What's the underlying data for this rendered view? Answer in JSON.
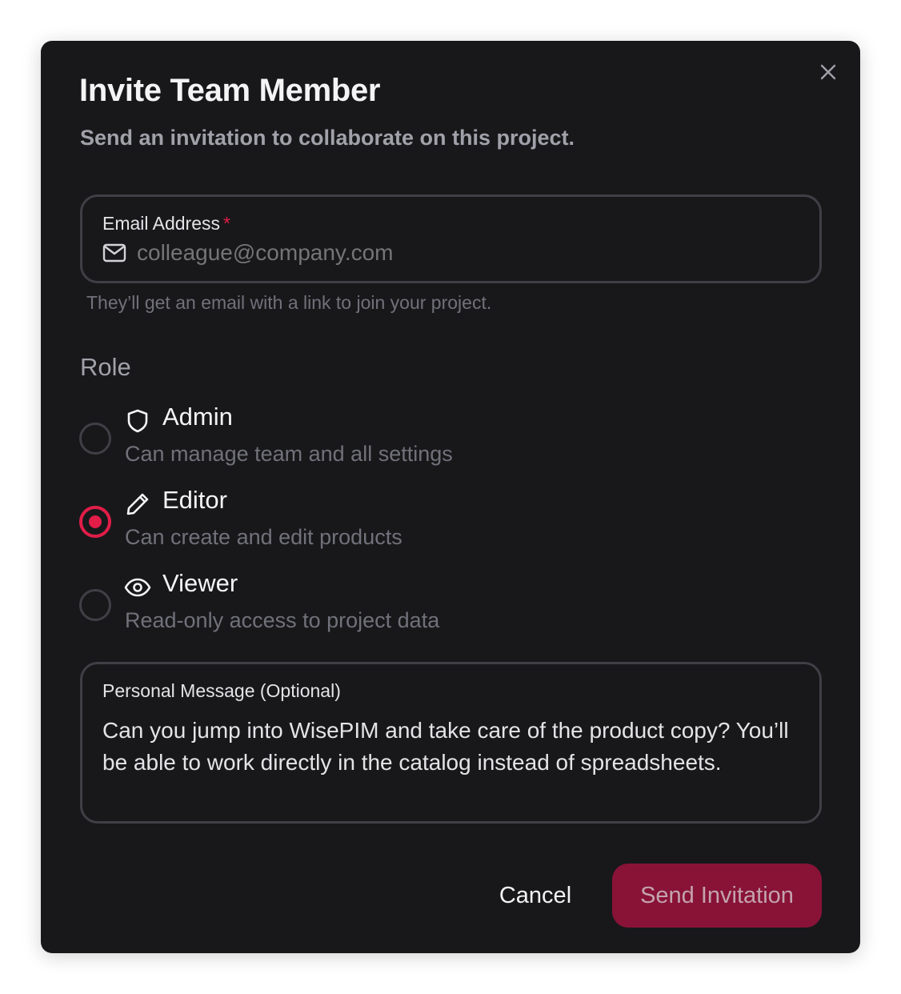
{
  "dialog": {
    "title": "Invite Team Member",
    "subtitle": "Send an invitation to collaborate on this project.",
    "close_icon": "close-icon"
  },
  "email": {
    "label": "Email Address",
    "required_mark": "*",
    "placeholder": "colleague@company.com",
    "value": "",
    "icon": "mail-icon",
    "helper": "They’ll get an email with a link to join your project."
  },
  "role": {
    "label": "Role",
    "selected": "Editor",
    "options": [
      {
        "name": "Admin",
        "description": "Can manage team and all settings",
        "icon": "shield-icon",
        "selected": false
      },
      {
        "name": "Editor",
        "description": "Can create and edit products",
        "icon": "pencil-icon",
        "selected": true
      },
      {
        "name": "Viewer",
        "description": "Read-only access to project data",
        "icon": "eye-icon",
        "selected": false
      }
    ]
  },
  "message": {
    "label": "Personal Message (Optional)",
    "value": "Can you jump into WisePIM and take care of the product copy? You’ll be able to work directly in the catalog instead of spreadsheets."
  },
  "actions": {
    "cancel_label": "Cancel",
    "send_label": "Send Invitation"
  },
  "colors": {
    "background": "#18181b",
    "accent": "#e11d48",
    "primary_button": "#881337",
    "border": "#3f3f46"
  }
}
